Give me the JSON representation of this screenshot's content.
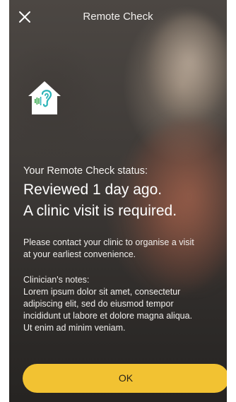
{
  "header": {
    "title": "Remote Check",
    "close_icon": "close-icon"
  },
  "logo": {
    "icon": "house-ear-icon",
    "accent_color": "#2bb3b8",
    "bars_color": "#34a84a"
  },
  "status": {
    "label": "Your Remote Check status:",
    "line1": "Reviewed 1 day ago.",
    "line2": "A clinic visit is required."
  },
  "instructions": {
    "line1": "Please contact your clinic to organise a visit",
    "line2": "at your earliest convenience."
  },
  "notes": {
    "heading": "Clinician's notes:",
    "line1": "Lorem ipsum dolor sit amet, consectetur",
    "line2": "adipiscing elit, sed do eiusmod tempor",
    "line3": "incididunt ut labore et dolore magna aliqua.",
    "line4": "Ut enim ad minim veniam."
  },
  "actions": {
    "ok_label": "OK",
    "ok_color": "#f2c232"
  }
}
